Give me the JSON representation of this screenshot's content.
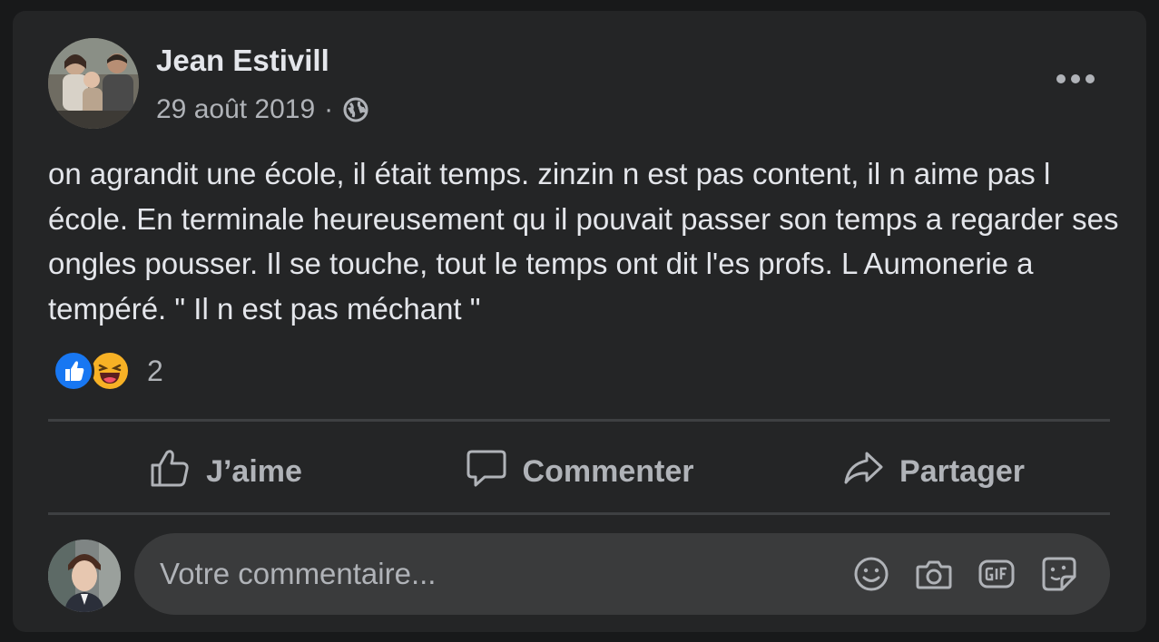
{
  "post": {
    "author": "Jean Estivill",
    "date": "29 août 2019",
    "separator": "·",
    "visibility_icon": "globe-icon",
    "more_icon": "more-options-icon",
    "text": "on agrandit une école, il était temps. zinzin n est pas content, il n aime pas l école. En terminale heureusement qu il pouvait passer son temps a regarder ses ongles pousser. Il se touche, tout le temps ont dit l'es profs. L Aumonerie a tempéré. \" Il n est pas méchant \""
  },
  "reactions": {
    "icons": [
      "like-reaction-icon",
      "haha-reaction-icon"
    ],
    "count": "2"
  },
  "actions": [
    {
      "label": "J’aime",
      "icon": "thumbs-up-icon"
    },
    {
      "label": "Commenter",
      "icon": "comment-icon"
    },
    {
      "label": "Partager",
      "icon": "share-icon"
    }
  ],
  "comment": {
    "placeholder": "Votre commentaire...",
    "icons": [
      "emoji-icon",
      "camera-icon",
      "gif-icon",
      "sticker-icon"
    ]
  },
  "colors": {
    "background": "#18191a",
    "card": "#242526",
    "primary_text": "#e4e6eb",
    "secondary_text": "#b0b3b8",
    "input_bg": "#3a3b3c",
    "like_blue": "#1877f2",
    "haha_yellow": "#f7b125"
  }
}
